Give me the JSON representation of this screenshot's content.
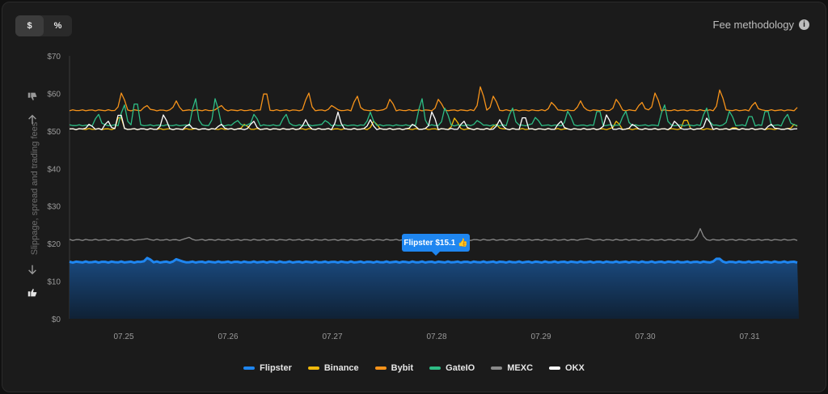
{
  "toolbar": {
    "currency_label": "$",
    "percent_label": "%",
    "fee_methodology_label": "Fee methodology",
    "info_glyph": "i"
  },
  "icons": {
    "thumbs_down": "thumbs-down-icon",
    "arrow_up": "arrow-up-icon",
    "arrow_down": "arrow-down-icon",
    "thumbs_up": "thumbs-up-icon",
    "info": "info-icon"
  },
  "tooltip": {
    "text": "Flipster $15.1 👍"
  },
  "chart_data": {
    "type": "line",
    "ylabel": "Slippage, spread and trading fees",
    "xlabel": "",
    "ylim": [
      0,
      70
    ],
    "yticks": [
      "$0",
      "$10",
      "$20",
      "$30",
      "$40",
      "$50",
      "$60",
      "$70"
    ],
    "x_ticks": [
      "07.25",
      "07.26",
      "07.27",
      "07.28",
      "07.29",
      "07.30",
      "07.31"
    ],
    "x_range": [
      "07.24 20:00",
      "07.31 14:00"
    ],
    "legend_position": "bottom-center",
    "grid": false,
    "series": [
      {
        "name": "Flipster",
        "color": "#1f86f0",
        "area": true,
        "baseline": 15.1,
        "spikes": [
          [
            180,
            16.4
          ],
          [
            216,
            16.0
          ],
          [
            885,
            16.4
          ]
        ],
        "points_approx": 230
      },
      {
        "name": "Binance",
        "color": "#f0b90b",
        "baseline": 50.5,
        "spikes": [
          [
            145,
            55
          ],
          [
            300,
            52
          ],
          [
            460,
            53
          ],
          [
            560,
            54
          ],
          [
            610,
            52
          ],
          [
            760,
            53
          ],
          [
            845,
            54
          ],
          [
            905,
            51
          ],
          [
            980,
            52
          ]
        ]
      },
      {
        "name": "Bybit",
        "color": "#f7931a",
        "baseline": 55.5,
        "spikes": [
          [
            148,
            61
          ],
          [
            178,
            57
          ],
          [
            215,
            58
          ],
          [
            270,
            57
          ],
          [
            325,
            62
          ],
          [
            378,
            61
          ],
          [
            408,
            57
          ],
          [
            438,
            60
          ],
          [
            480,
            59
          ],
          [
            540,
            59
          ],
          [
            592,
            63
          ],
          [
            608,
            60
          ],
          [
            680,
            58
          ],
          [
            715,
            58
          ],
          [
            760,
            59
          ],
          [
            790,
            58
          ],
          [
            808,
            61
          ],
          [
            888,
            62
          ],
          [
            930,
            58
          ],
          [
            986,
            57
          ]
        ]
      },
      {
        "name": "GateIO",
        "color": "#2ebd85",
        "baseline": 51.5,
        "spikes": [
          [
            118,
            55
          ],
          [
            150,
            58
          ],
          [
            165,
            60
          ],
          [
            238,
            60
          ],
          [
            264,
            60
          ],
          [
            290,
            53
          ],
          [
            312,
            55
          ],
          [
            350,
            55
          ],
          [
            400,
            53
          ],
          [
            455,
            55
          ],
          [
            518,
            60
          ],
          [
            548,
            57
          ],
          [
            588,
            53
          ],
          [
            630,
            57
          ],
          [
            660,
            54
          ],
          [
            700,
            56
          ],
          [
            737,
            57
          ],
          [
            770,
            56
          ],
          [
            818,
            58
          ],
          [
            870,
            57
          ],
          [
            900,
            56
          ],
          [
            925,
            55
          ],
          [
            945,
            57
          ],
          [
            970,
            55
          ]
        ]
      },
      {
        "name": "MEXC",
        "color": "#8a8a8a",
        "baseline": 21.0,
        "spikes": [
          [
            178,
            21.4
          ],
          [
            230,
            21.8
          ],
          [
            534,
            21.3
          ],
          [
            722,
            21.4
          ],
          [
            863,
            24.0
          ]
        ]
      },
      {
        "name": "OKX",
        "color": "#ffffff",
        "baseline": 50.5,
        "spikes": [
          [
            108,
            52
          ],
          [
            130,
            53
          ],
          [
            145,
            56
          ],
          [
            200,
            55
          ],
          [
            230,
            52
          ],
          [
            270,
            52
          ],
          [
            310,
            53
          ],
          [
            375,
            53
          ],
          [
            415,
            55
          ],
          [
            455,
            53
          ],
          [
            508,
            52
          ],
          [
            532,
            56
          ],
          [
            570,
            53
          ],
          [
            615,
            53
          ],
          [
            645,
            55
          ],
          [
            690,
            53
          ],
          [
            748,
            55
          ],
          [
            780,
            52
          ],
          [
            832,
            53
          ],
          [
            872,
            54
          ],
          [
            950,
            52
          ]
        ]
      }
    ]
  }
}
